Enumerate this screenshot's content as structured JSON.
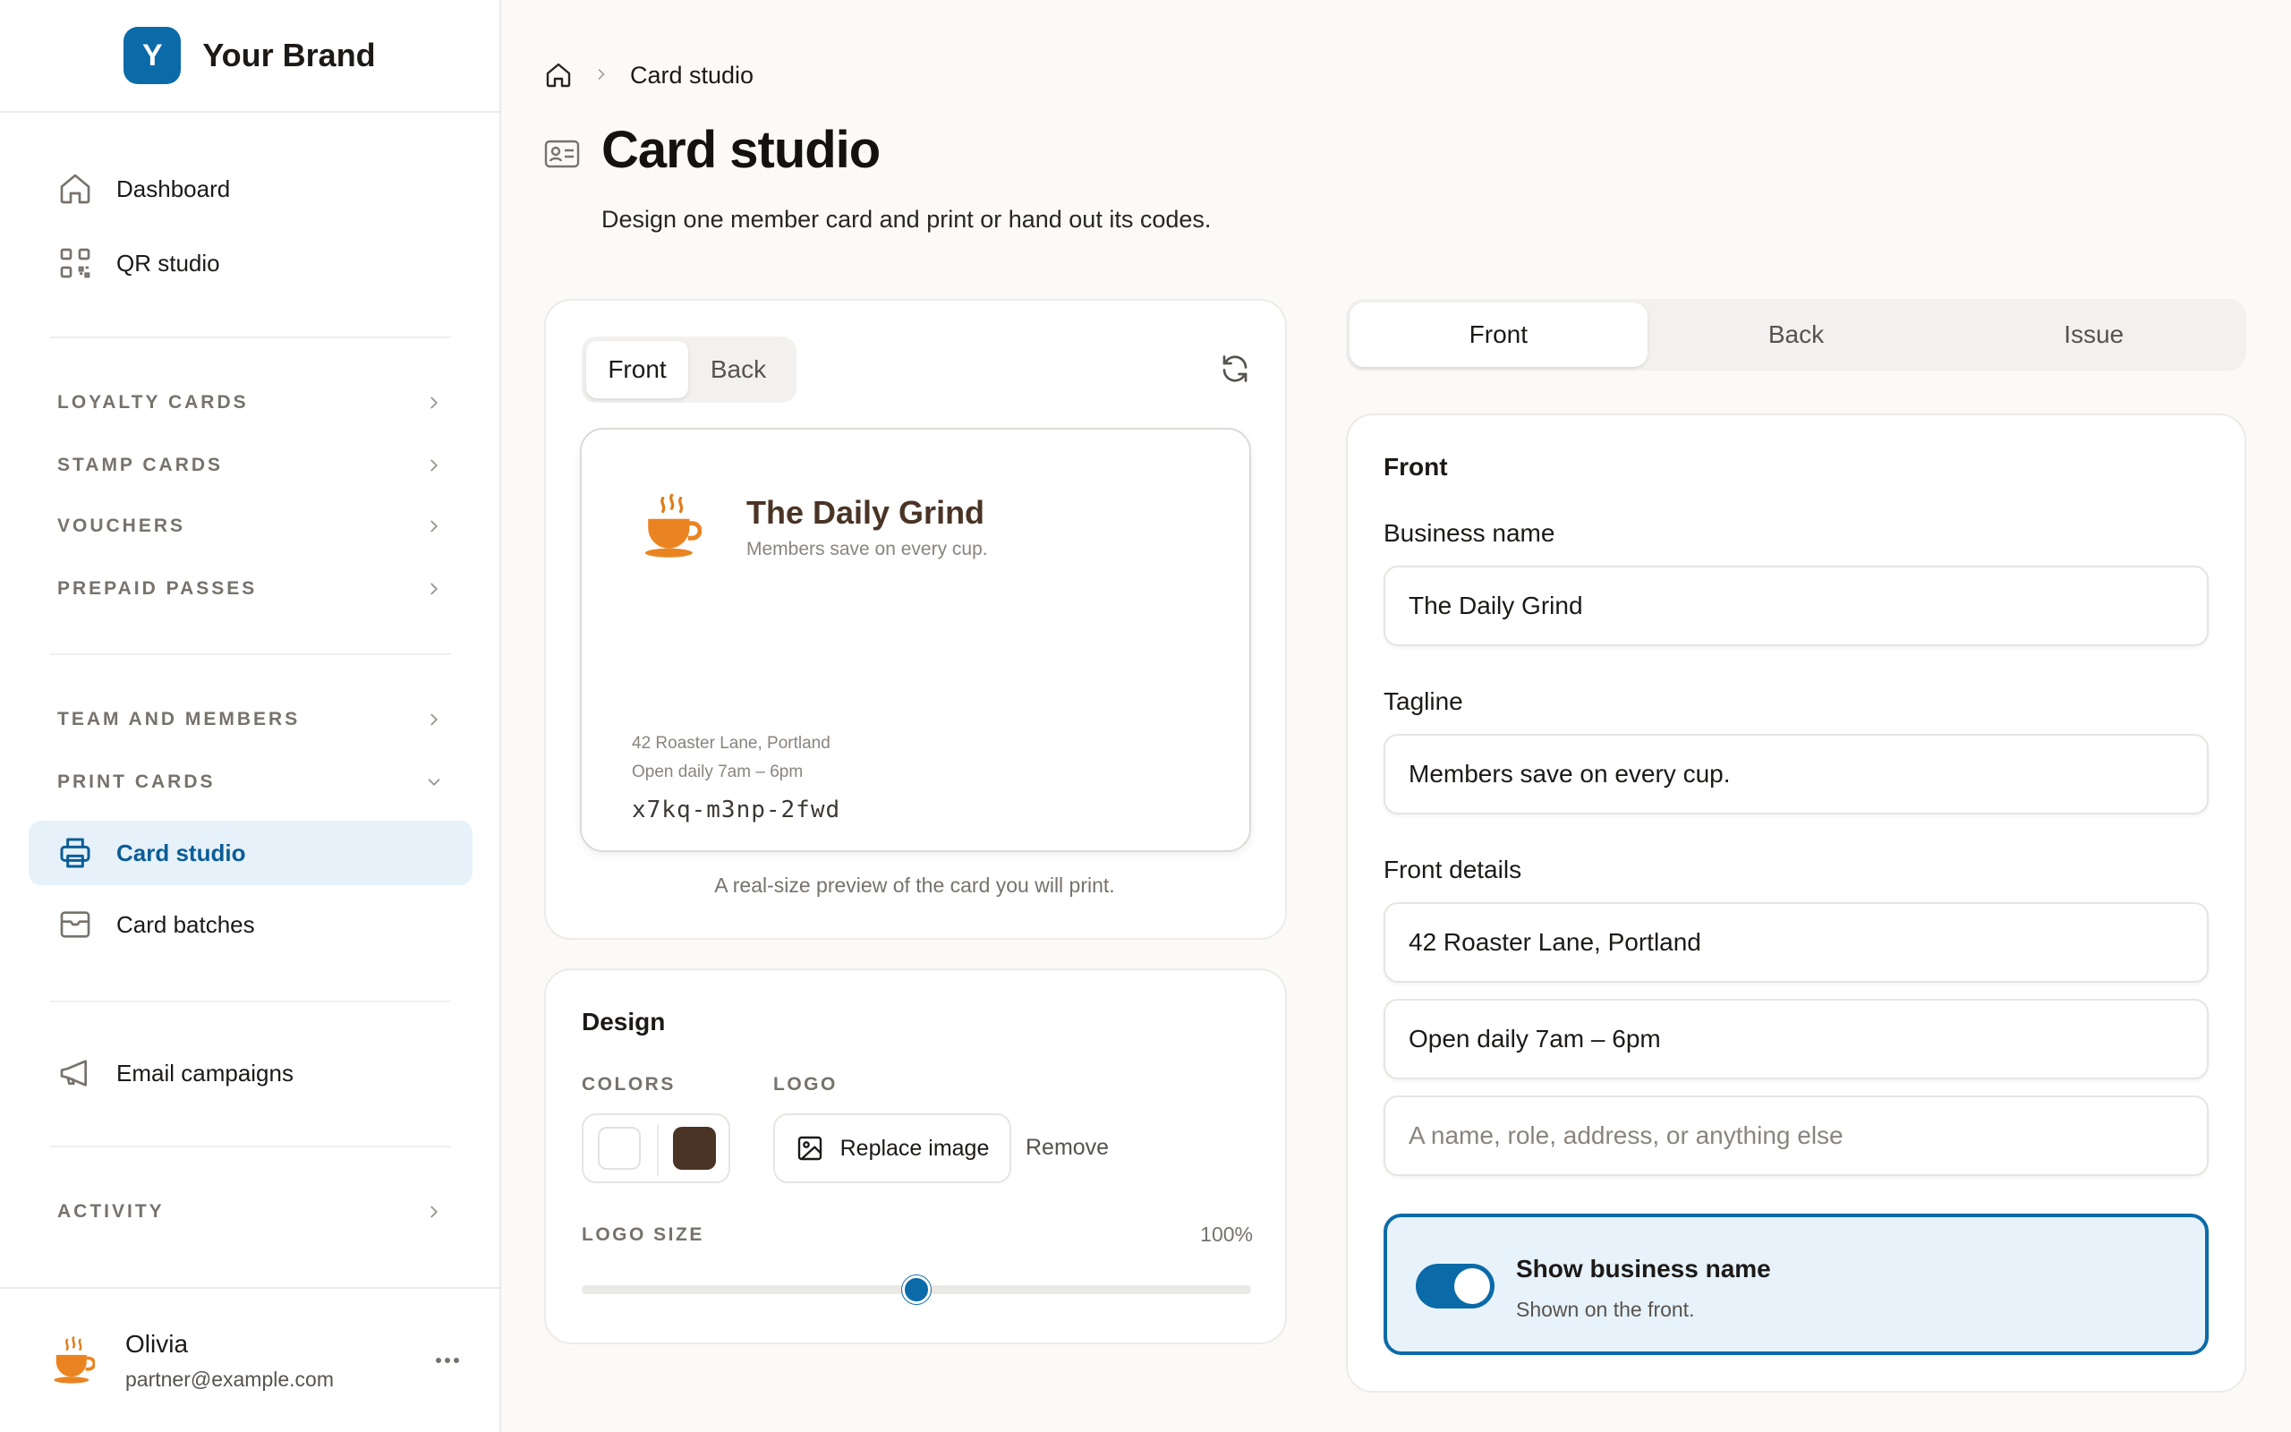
{
  "brand": {
    "logo_letter": "Y",
    "name": "Your Brand",
    "accent": "#0b6aa8"
  },
  "sidebar": {
    "top_items": [
      {
        "label": "Dashboard",
        "icon": "home-icon"
      },
      {
        "label": "QR studio",
        "icon": "qr-code-icon"
      }
    ],
    "sections": [
      {
        "label": "LOYALTY CARDS",
        "expanded": false
      },
      {
        "label": "STAMP CARDS",
        "expanded": false
      },
      {
        "label": "VOUCHERS",
        "expanded": false
      },
      {
        "label": "PREPAID PASSES",
        "expanded": false
      },
      {
        "label": "TEAM AND MEMBERS",
        "expanded": false
      },
      {
        "label": "PRINT CARDS",
        "expanded": true
      },
      {
        "label": "ACTIVITY",
        "expanded": false
      }
    ],
    "print_items": [
      {
        "label": "Card studio",
        "icon": "printer-icon",
        "active": true
      },
      {
        "label": "Card batches",
        "icon": "inbox-icon",
        "active": false
      }
    ],
    "other_items": [
      {
        "label": "Email campaigns",
        "icon": "megaphone-icon"
      }
    ],
    "user": {
      "name": "Olivia",
      "email": "partner@example.com"
    }
  },
  "breadcrumb": {
    "current": "Card studio"
  },
  "page": {
    "title": "Card studio",
    "subtitle": "Design one member card and print or hand out its codes."
  },
  "preview": {
    "segments": [
      "Front",
      "Back"
    ],
    "selected": "Front",
    "card": {
      "business_name": "The Daily Grind",
      "tagline": "Members save on every cup.",
      "detail_lines": [
        "42 Roaster Lane, Portland",
        "Open daily 7am – 6pm"
      ],
      "code": "x7kq-m3np-2fwd",
      "name_color": "#4a3426"
    },
    "caption": "A real-size preview of the card you will print."
  },
  "design": {
    "title": "Design",
    "colors_label": "COLORS",
    "colors": [
      "#ffffff",
      "#4a3426"
    ],
    "logo_label": "LOGO",
    "replace_label": "Replace image",
    "remove_label": "Remove",
    "logo_size_label": "LOGO SIZE",
    "logo_size_value": "100%",
    "logo_size_fraction": 0.5
  },
  "editor": {
    "tabs": [
      "Front",
      "Back",
      "Issue"
    ],
    "selected_tab": "Front",
    "heading": "Front",
    "business_name_label": "Business name",
    "business_name_value": "The Daily Grind",
    "tagline_label": "Tagline",
    "tagline_value": "Members save on every cup.",
    "front_details_label": "Front details",
    "detail_1": "42 Roaster Lane, Portland",
    "detail_2": "Open daily 7am – 6pm",
    "detail_3_placeholder": "A name, role, address, or anything else",
    "toggle": {
      "title": "Show business name",
      "subtitle": "Shown on the front.",
      "on": true
    }
  }
}
